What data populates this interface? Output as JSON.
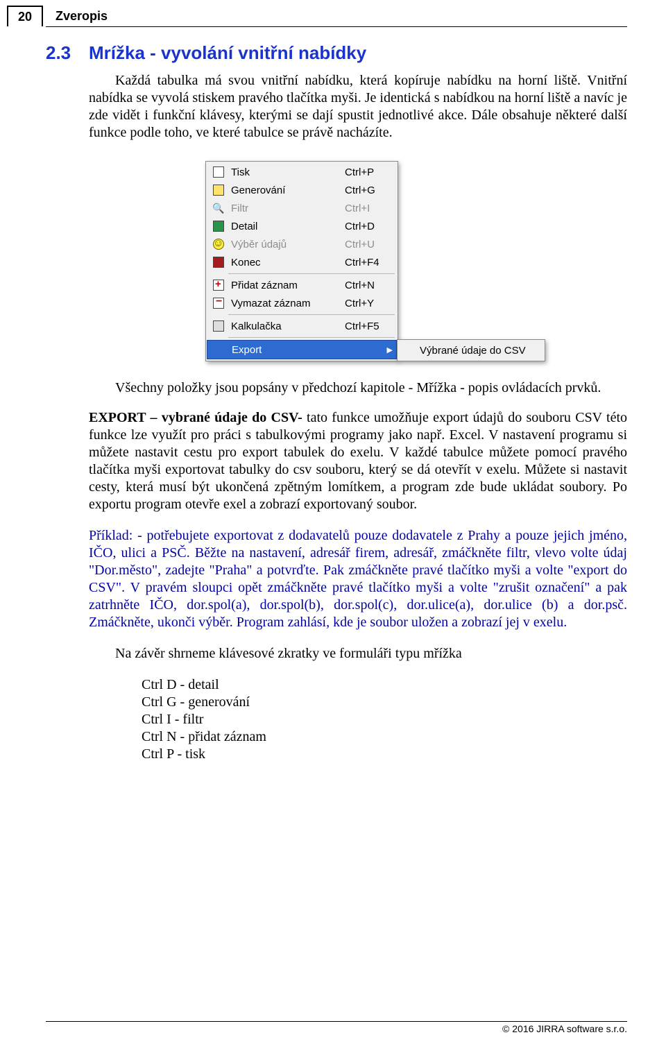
{
  "header": {
    "page_number": "20",
    "title": "Zveropis"
  },
  "section": {
    "number": "2.3",
    "title": "Mrížka - vyvolání vnitřní nabídky"
  },
  "paragraphs": {
    "intro": "Každá tabulka má svou vnitřní nabídku, která kopíruje nabídku na horní liště. Vnitřní nabídka se vyvolá stiskem pravého tlačítka myši. Je identická s nabídkou na horní liště a navíc je zde vidět i funkční klávesy, kterými se dají spustit jednotlivé akce. Dále obsahuje některé další funkce podle toho, ve které tabulce se právě nacházíte.",
    "after_menu": "Všechny položky jsou popsány v předchozí kapitole - Mřížka - popis ovládacích prvků.",
    "export_lead": "EXPORT – vybrané údaje do CSV-",
    "export_body": "  tato funkce umožňuje export údajů do souboru CSV této funkce lze využít pro práci s tabulkovými programy jako např. Excel. V nastavení programu si můžete nastavit cestu pro export tabulek do exelu. V každé tabulce můžete pomocí pravého tlačítka myši exportovat tabulky do csv souboru, který se dá otevřít v exelu. Můžete si nastavit cesty, která musí být ukončená zpětným lomítkem, a program zde bude ukládat soubory. Po exportu program otevře exel a zobrazí exportovaný soubor.",
    "example": "Příklad: - potřebujete exportovat z dodavatelů pouze dodavatele z Prahy a pouze jejich jméno, IČO, ulici a PSČ. Běžte na nastavení, adresář firem, adresář, zmáčkněte filtr, vlevo volte údaj \"Dor.město\", zadejte \"Praha\" a potvrďte. Pak zmáčkněte pravé tlačítko myši a volte \"export do CSV\". V pravém sloupci opět zmáčkněte pravé tlačítko myši a volte \"zrušit označení\" a pak zatrhněte IČO, dor.spol(a), dor.spol(b), dor.spol(c), dor.ulice(a), dor.ulice (b) a dor.psč. Zmáčkněte, ukonči výběr. Program zahlásí, kde je soubor uložen a zobrazí jej v exelu.",
    "shortcuts_intro": "Na závěr shrneme klávesové zkratky ve formuláři typu mřížka"
  },
  "shortcuts_list": [
    "Ctrl D - detail",
    "Ctrl G - generování",
    "Ctrl I - filtr",
    "Ctrl N - přidat záznam",
    "Ctrl P - tisk"
  ],
  "menu": {
    "items": [
      {
        "label": "Tisk",
        "shortcut": "Ctrl+P",
        "icon": "print",
        "enabled": true
      },
      {
        "label": "Generování",
        "shortcut": "Ctrl+G",
        "icon": "gen",
        "enabled": true
      },
      {
        "label": "Filtr",
        "shortcut": "Ctrl+I",
        "icon": "filter",
        "enabled": false
      },
      {
        "label": "Detail",
        "shortcut": "Ctrl+D",
        "icon": "det",
        "enabled": true
      },
      {
        "label": "Výběr údajů",
        "shortcut": "Ctrl+U",
        "icon": "sel",
        "enabled": false
      },
      {
        "label": "Konec",
        "shortcut": "Ctrl+F4",
        "icon": "end",
        "enabled": true
      },
      {
        "label": "Přidat záznam",
        "shortcut": "Ctrl+N",
        "icon": "add",
        "enabled": true
      },
      {
        "label": "Vymazat záznam",
        "shortcut": "Ctrl+Y",
        "icon": "del",
        "enabled": true
      },
      {
        "label": "Kalkulačka",
        "shortcut": "Ctrl+F5",
        "icon": "calc",
        "enabled": true
      },
      {
        "label": "Export",
        "shortcut": "",
        "icon": "",
        "enabled": true,
        "highlight": true,
        "submenu": true
      }
    ],
    "submenu_label": "Výbrané údaje do CSV",
    "arrow": "▶"
  },
  "footer": "© 2016 JIRRA software s.r.o."
}
